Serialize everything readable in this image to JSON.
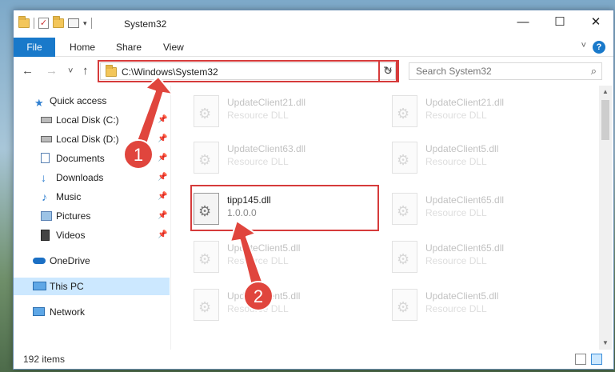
{
  "window": {
    "title": "System32"
  },
  "controls": {
    "minimize": "—",
    "maximize": "☐",
    "close": "✕"
  },
  "menu": {
    "file": "File",
    "home": "Home",
    "share": "Share",
    "view": "View",
    "help": "?"
  },
  "nav": {
    "back": "←",
    "forward": "→",
    "recent": "˅",
    "up": "↑"
  },
  "address": {
    "path": "C:\\Windows\\System32",
    "dropdown": "˅",
    "refresh": "↻"
  },
  "search": {
    "placeholder": "Search System32"
  },
  "sidebar": {
    "items": [
      {
        "label": "Quick access",
        "icon": "star-icon"
      },
      {
        "label": "Local Disk (C:)",
        "icon": "drive-icon",
        "pinned": true
      },
      {
        "label": "Local Disk (D:)",
        "icon": "drive-icon",
        "pinned": true
      },
      {
        "label": "Documents",
        "icon": "documents-icon",
        "pinned": true
      },
      {
        "label": "Downloads",
        "icon": "download-icon",
        "pinned": true
      },
      {
        "label": "Music",
        "icon": "music-icon",
        "pinned": true
      },
      {
        "label": "Pictures",
        "icon": "pictures-icon",
        "pinned": true
      },
      {
        "label": "Videos",
        "icon": "videos-icon",
        "pinned": true
      },
      {
        "label": "OneDrive",
        "icon": "cloud-icon"
      },
      {
        "label": "This PC",
        "icon": "computer-icon",
        "selected": true
      },
      {
        "label": "Network",
        "icon": "network-icon"
      }
    ]
  },
  "files": [
    {
      "name": "UpdateClient21.dll",
      "type": "Resource DLL"
    },
    {
      "name": "UpdateClient21.dll",
      "type": "Resource DLL"
    },
    {
      "name": "UpdateClient63.dll",
      "type": "Resource DLL"
    },
    {
      "name": "UpdateClient5.dll",
      "type": "Resource DLL"
    },
    {
      "name": "tipp145.dll",
      "type": "1.0.0.0"
    },
    {
      "name": "UpdateClient65.dll",
      "type": "Resource DLL"
    },
    {
      "name": "UpdateClient5.dll",
      "type": "Resource DLL"
    },
    {
      "name": "UpdateClient65.dll",
      "type": "Resource DLL"
    },
    {
      "name": "UpdateClient5.dll",
      "type": "Resource DLL"
    },
    {
      "name": "UpdateClient5.dll",
      "type": "Resource DLL"
    }
  ],
  "status": {
    "count": "192 items"
  },
  "annotations": {
    "step1": "1",
    "step2": "2"
  },
  "colors": {
    "accent": "#1979ca",
    "highlight": "#d63b3b",
    "selection": "#cce8ff"
  }
}
